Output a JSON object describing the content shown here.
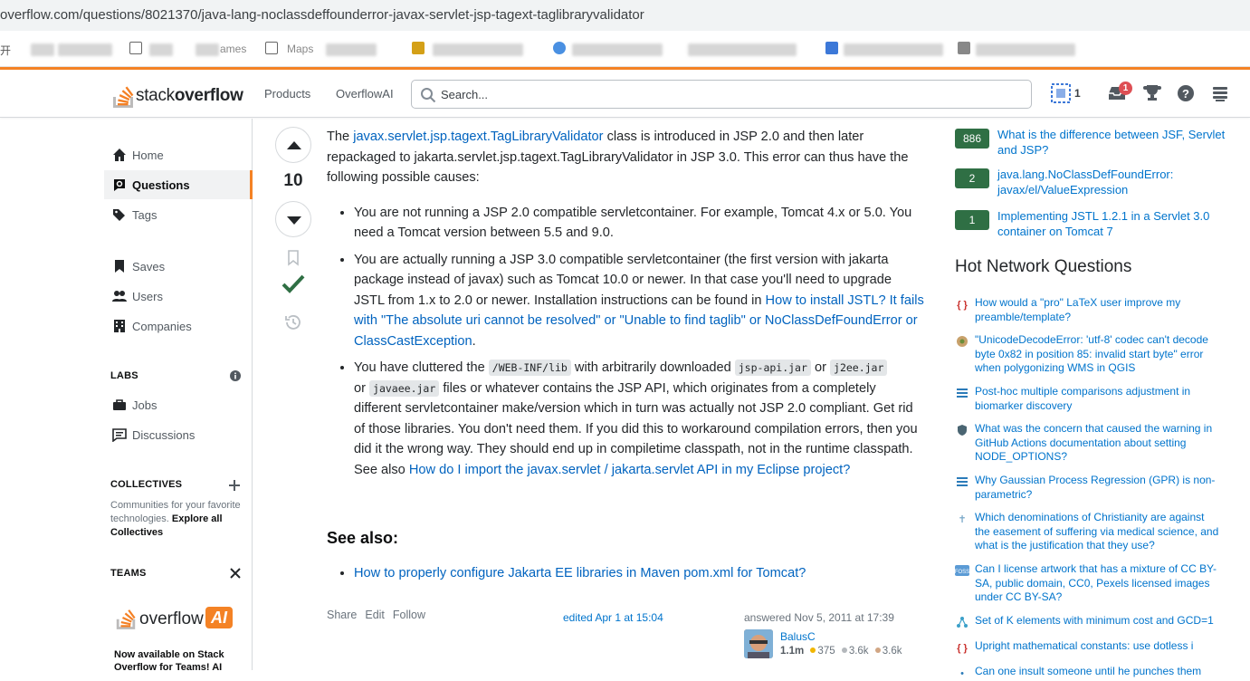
{
  "browser": {
    "url": "overflow.com/questions/8021370/java-lang-noclassdeffounderror-javax-servlet-jsp-tagext-taglibraryvalidator",
    "bookmarks": [
      "开",
      "ames",
      "Maps"
    ]
  },
  "header": {
    "logo_regular": "stack",
    "logo_bold": "overflow",
    "nav": [
      "Products",
      "OverflowAI"
    ],
    "search_placeholder": "Search...",
    "reputation": "1",
    "inbox_count": "1"
  },
  "sidebar": {
    "items": [
      {
        "label": "Home",
        "icon": "home-icon"
      },
      {
        "label": "Questions",
        "icon": "questions-icon",
        "active": true
      },
      {
        "label": "Tags",
        "icon": "tags-icon"
      },
      {
        "label": "Saves",
        "icon": "bookmark-icon"
      },
      {
        "label": "Users",
        "icon": "users-icon"
      },
      {
        "label": "Companies",
        "icon": "companies-icon"
      }
    ],
    "labs_heading": "LABS",
    "labs_items": [
      {
        "label": "Jobs",
        "icon": "briefcase-icon"
      },
      {
        "label": "Discussions",
        "icon": "discussions-icon"
      }
    ],
    "collectives_heading": "COLLECTIVES",
    "collectives_text": "Communities for your favorite technologies.",
    "collectives_link": "Explore all Collectives",
    "teams_heading": "TEAMS",
    "overflow_ai_text": "overflow",
    "overflow_ai_badge": "AI",
    "teams_promo": "Now available on Stack Overflow for Teams! AI"
  },
  "answer": {
    "votes": "10",
    "accepted": true,
    "intro_before": "The ",
    "intro_link": "javax.servlet.jsp.tagext.TagLibraryValidator",
    "intro_after": " class is introduced in JSP 2.0 and then later repackaged to jakarta.servlet.jsp.tagext.TagLibraryValidator in JSP 3.0. This error can thus have the following possible causes:",
    "bullet1": "You are not running a JSP 2.0 compatible servletcontainer. For example, Tomcat 4.x or 5.0. You need a Tomcat version between 5.5 and 9.0.",
    "bullet2_text": "You are actually running a JSP 3.0 compatible servletcontainer (the first version with jakarta package instead of javax) such as Tomcat 10.0 or newer. In that case you'll need to upgrade JSTL from 1.x to 2.0 or newer. Installation instructions can be found in ",
    "bullet2_link": "How to install JSTL? It fails with \"The absolute uri cannot be resolved\" or \"Unable to find taglib\" or NoClassDefFoundError or ClassCastException",
    "bullet2_end": ".",
    "bullet3_a": "You have cluttered the ",
    "bullet3_code1": "/WEB-INF/lib",
    "bullet3_b": " with arbitrarily downloaded ",
    "bullet3_code2": "jsp-api.jar",
    "bullet3_c": " or ",
    "bullet3_code3": "j2ee.jar",
    "bullet3_d": " or ",
    "bullet3_code4": "javaee.jar",
    "bullet3_e": " files or whatever contains the JSP API, which originates from a completely different servletcontainer make/version which in turn was actually not JSP 2.0 compliant. Get rid of those libraries. You don't need them. If you did this to workaround compilation errors, then you did it the wrong way. They should end up in compiletime classpath, not in the runtime classpath. See also ",
    "bullet3_link": "How do I import the javax.servlet / jakarta.servlet API in my Eclipse project?",
    "see_also_heading": "See also:",
    "see_also_link": "How to properly configure Jakarta EE libraries in Maven pom.xml for Tomcat?",
    "menu": [
      "Share",
      "Edit",
      "Follow"
    ],
    "edited": "edited Apr 1 at 15:04",
    "answered": "answered Nov 5, 2011 at 17:39",
    "user": {
      "name": "BalusC",
      "reputation": "1.1m",
      "gold": "375",
      "silver": "3.6k",
      "bronze": "3.6k"
    }
  },
  "related": [
    {
      "score": "886",
      "title": "What is the difference between JSF, Servlet and JSP?"
    },
    {
      "score": "2",
      "title": "java.lang.NoClassDefFoundError: javax/el/ValueExpression"
    },
    {
      "score": "1",
      "title": "Implementing JSTL 1.2.1 in a Servlet 3.0 container on Tomcat 7"
    }
  ],
  "hnq": {
    "heading": "Hot Network Questions",
    "items": [
      {
        "icon": "tex-icon",
        "title": "How would a \"pro\" LaTeX user improve my preamble/template?"
      },
      {
        "icon": "gis-icon",
        "title": "\"UnicodeDecodeError: 'utf-8' codec can't decode byte 0x82 in position 85: invalid start byte\" error when polygonizing WMS in QGIS"
      },
      {
        "icon": "stats-icon",
        "title": "Post-hoc multiple comparisons adjustment in biomarker discovery"
      },
      {
        "icon": "security-icon",
        "title": "What was the concern that caused the warning in GitHub Actions documentation about setting NODE_OPTIONS?"
      },
      {
        "icon": "stats-icon",
        "title": "Why Gaussian Process Regression (GPR) is non-parametric?"
      },
      {
        "icon": "christianity-icon",
        "title": "Which denominations of Christianity are against the easement of suffering via medical science, and what is the justification that they use?"
      },
      {
        "icon": "opensource-icon",
        "title": "Can I license artwork that has a mixture of CC BY-SA, public domain, CC0, Pexels licensed images under CC BY-SA?"
      },
      {
        "icon": "math-icon",
        "title": "Set of K elements with minimum cost and GCD=1"
      },
      {
        "icon": "tex-icon",
        "title": "Upright mathematical constants: use dotless i"
      },
      {
        "icon": "english-icon",
        "title": "Can one insult someone until he punches them"
      }
    ]
  }
}
